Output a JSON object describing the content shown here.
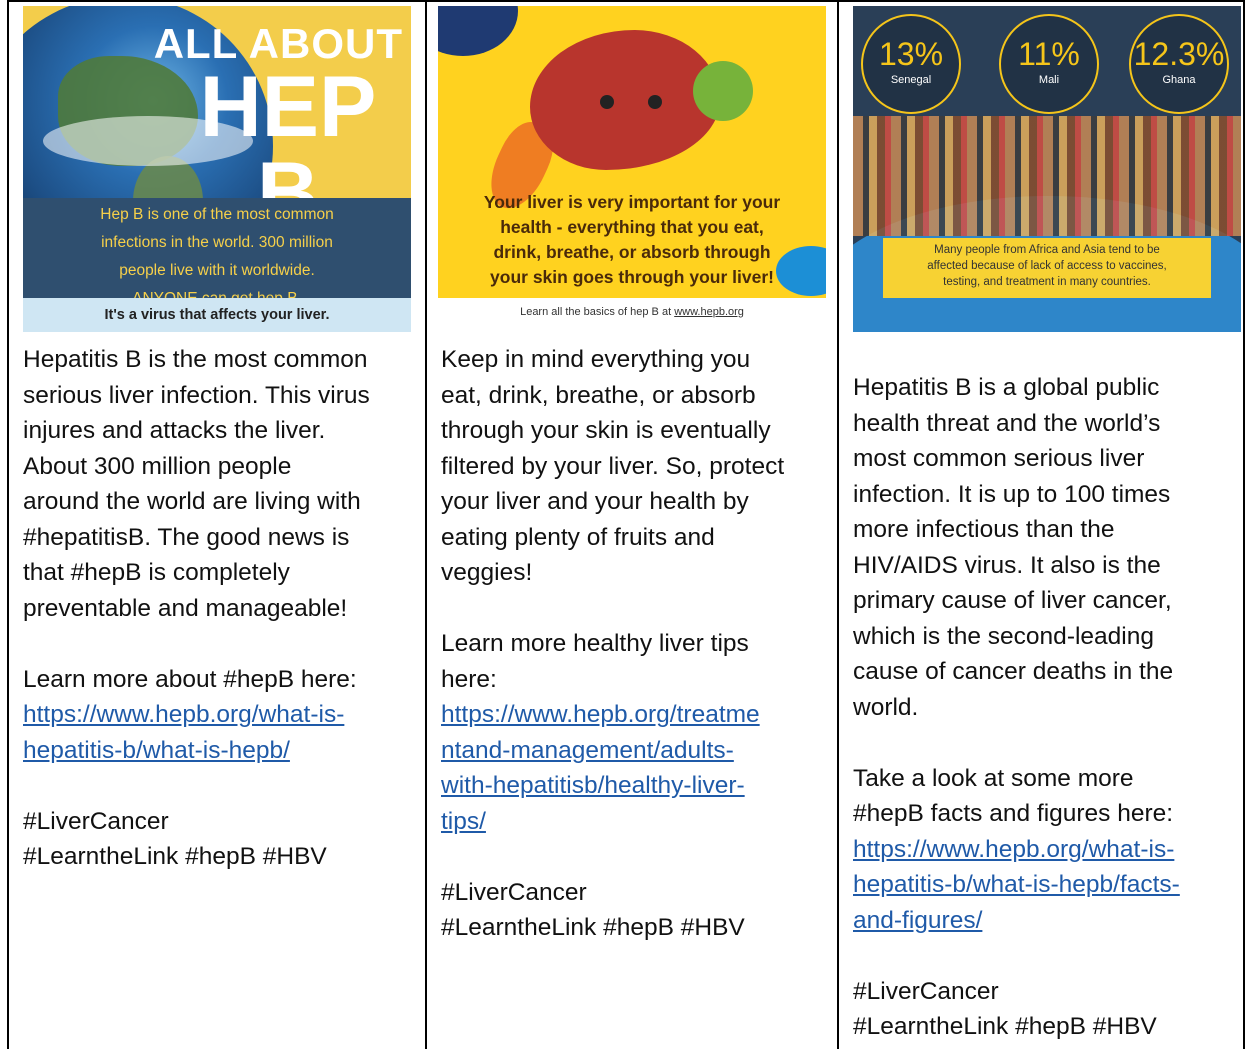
{
  "columns": [
    {
      "image": {
        "title_top": "ALL ABOUT",
        "title_big": "HEP B",
        "band_lines": [
          "Hep B is one of the most common",
          "infections in the world. 300 million",
          "people live with it worldwide.",
          "ANYONE can get hep B."
        ],
        "strip": "It's a virus that affects your liver."
      },
      "body": [
        "Hepatitis B is the most common",
        "serious liver infection. This virus",
        "injures and attacks the liver.",
        "About 300 million people",
        "around the world are living with",
        "#hepatitisB. The good news is",
        "that #hepB is completely",
        "preventable and manageable!"
      ],
      "learn": "Learn more about #hepB here:",
      "link_lines": [
        "https://www.hepb.org/what-is-",
        "hepatitis-b/what-is-hepb/"
      ],
      "tags_1": "#LiverCancer",
      "tags_2": "#LearntheLink #hepB #HBV"
    },
    {
      "image": {
        "caption_lines": [
          "Your liver is very important for your",
          "health - everything that you eat,",
          "drink, breathe, or absorb through",
          "your skin goes through your liver!"
        ],
        "foot_text": "Learn all the basics of hep B at ",
        "foot_link": "www.hepb.org"
      },
      "body": [
        "Keep in mind everything you",
        "eat, drink, breathe, or absorb",
        "through your skin is eventually",
        "filtered by your liver. So, protect",
        "your liver and your health by",
        "eating plenty of fruits and",
        "veggies!"
      ],
      "learn_lines": [
        "Learn more healthy liver tips",
        "here:"
      ],
      "link_lines": [
        "https://www.hepb.org/treatme",
        "ntand-management/adults-",
        "with-hepatitisb/healthy-liver-",
        "tips/"
      ],
      "tags_1": "#LiverCancer",
      "tags_2": "#LearntheLink #hepB #HBV"
    },
    {
      "image": {
        "stats": [
          {
            "pct": "13%",
            "country": "Senegal"
          },
          {
            "pct": "11%",
            "country": "Mali"
          },
          {
            "pct": "12.3%",
            "country": "Ghana"
          }
        ],
        "box_lines": [
          "Many people from Africa and Asia tend to be",
          "affected because of lack of access to vaccines,",
          "testing, and treatment in many countries."
        ]
      },
      "body": [
        "Hepatitis B is a global public",
        "health threat and the world’s",
        "most common serious liver",
        "infection. It is up to 100 times",
        "more infectious than the",
        "HIV/AIDS virus. It also is the",
        "primary cause of liver cancer,",
        "which is the second-leading",
        "cause of cancer deaths in the",
        "world."
      ],
      "learn_lines": [
        "Take a look at some more",
        "#hepB facts and figures here:"
      ],
      "link_lines": [
        "https://www.hepb.org/what-is-",
        "hepatitis-b/what-is-hepb/facts-",
        "and-figures/ "
      ],
      "tags_1": "#LiverCancer",
      "tags_2": "#LearntheLink #hepB #HBV"
    }
  ]
}
